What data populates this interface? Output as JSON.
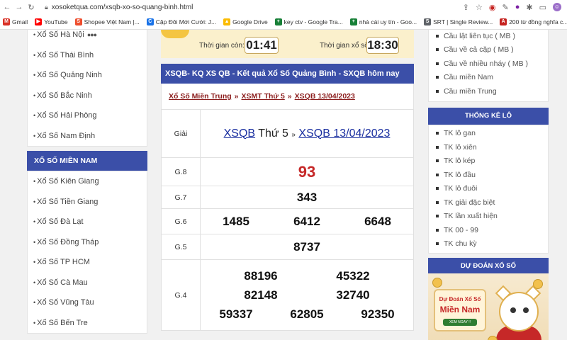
{
  "browser": {
    "url": "xosoketqua.com/xsqb-xo-so-quang-binh.html",
    "bookmarks": [
      {
        "label": "Gmail",
        "icon": "gmail-icon",
        "color": "#d93025",
        "glyph": "M"
      },
      {
        "label": "YouTube",
        "icon": "youtube-icon",
        "color": "#ff0000",
        "glyph": "▶"
      },
      {
        "label": "Shopee Việt Nam |...",
        "icon": "shopee-icon",
        "color": "#ee4d2d",
        "glyph": "S"
      },
      {
        "label": "Cặp Đôi Mới Cưới: J...",
        "icon": "link-icon",
        "color": "#1a73e8",
        "glyph": "C"
      },
      {
        "label": "Google Drive",
        "icon": "drive-icon",
        "color": "#fbbc04",
        "glyph": "▲"
      },
      {
        "label": "key ctv - Google Tra...",
        "icon": "sheets-icon",
        "color": "#188038",
        "glyph": "+"
      },
      {
        "label": "nhà cái uy tín - Goo...",
        "icon": "sheets-icon",
        "color": "#188038",
        "glyph": "+"
      },
      {
        "label": "SRT | Single Review...",
        "icon": "srt-icon",
        "color": "#5f6368",
        "glyph": "S"
      },
      {
        "label": "200 từ đồng nghĩa c...",
        "icon": "site-icon",
        "color": "#c5221f",
        "glyph": "A"
      }
    ]
  },
  "left": {
    "north_items": [
      "Xổ Số Hà Nội",
      "Xổ Số Thái Bình",
      "Xổ Số Quảng Ninh",
      "Xổ Số Bắc Ninh",
      "Xổ Số Hải Phòng",
      "Xổ Số Nam Định"
    ],
    "south_heading": "XỔ SỐ MIỀN NAM",
    "south_items": [
      "Xổ Số Kiên Giang",
      "Xổ Số Tiền Giang",
      "Xổ Số Đà Lạt",
      "Xổ Số Đồng Tháp",
      "Xổ Số TP HCM",
      "Xổ Số Cà Mau",
      "Xổ Số Vũng Tàu",
      "Xổ Số Bến Tre"
    ]
  },
  "timer": {
    "remaining_label": "Thời gian còn:",
    "remaining_value": "01:41",
    "draw_label": "Thời gian xổ số:",
    "draw_value": "18:30"
  },
  "main": {
    "title": "XSQB- KQ XS QB - Kết quả Xổ Số Quảng Bình - SXQB hôm nay",
    "breadcrumb": [
      "Xổ Số Miền Trung",
      "XSMT Thứ 5",
      "XSQB 13/04/2023"
    ],
    "breadcrumb_sep": "»",
    "table_head": {
      "col": "Giải",
      "link1": "XSQB",
      "mid": "Thứ 5",
      "sep": "»",
      "link2": "XSQB 13/04/2023"
    },
    "prizes": [
      {
        "name": "G.8",
        "numbers": [
          "93"
        ]
      },
      {
        "name": "G.7",
        "numbers": [
          "343"
        ]
      },
      {
        "name": "G.6",
        "numbers": [
          "1485",
          "6412",
          "6648"
        ]
      },
      {
        "name": "G.5",
        "numbers": [
          "8737"
        ]
      },
      {
        "name": "G.4",
        "numbers": [
          "88196",
          "45322",
          "82148",
          "32740",
          "59337",
          "62805",
          "92350"
        ]
      }
    ]
  },
  "right": {
    "cau_items": [
      "Cầu lật liên tục ( MB )",
      "Cầu về cả cặp ( MB )",
      "Cầu về nhiều nháy ( MB )",
      "Cầu miền Nam",
      "Cầu miền Trung"
    ],
    "stats_heading": "THỐNG KÊ LÔ",
    "stats_items": [
      "TK lô gan",
      "TK lô xiên",
      "TK lô kép",
      "TK lô đầu",
      "TK lô đuôi",
      "TK giải đặc biệt",
      "TK lần xuất hiện",
      "TK 00 - 99",
      "TK chu kỳ"
    ],
    "predict_heading": "DỰ ĐOÁN XỔ SỐ",
    "banner_line1": "Dự Đoán Xổ Số",
    "banner_line2": "Miền Nam",
    "banner_button": "XEM NGAY !!"
  }
}
